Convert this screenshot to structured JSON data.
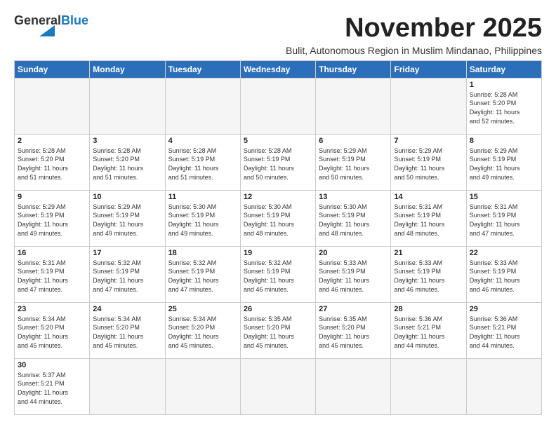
{
  "logo": {
    "general": "General",
    "blue": "Blue"
  },
  "title": "November 2025",
  "subtitle": "Bulit, Autonomous Region in Muslim Mindanao, Philippines",
  "days_of_week": [
    "Sunday",
    "Monday",
    "Tuesday",
    "Wednesday",
    "Thursday",
    "Friday",
    "Saturday"
  ],
  "weeks": [
    [
      {
        "day": "",
        "info": ""
      },
      {
        "day": "",
        "info": ""
      },
      {
        "day": "",
        "info": ""
      },
      {
        "day": "",
        "info": ""
      },
      {
        "day": "",
        "info": ""
      },
      {
        "day": "",
        "info": ""
      },
      {
        "day": "1",
        "info": "Sunrise: 5:28 AM\nSunset: 5:20 PM\nDaylight: 11 hours\nand 52 minutes."
      }
    ],
    [
      {
        "day": "2",
        "info": "Sunrise: 5:28 AM\nSunset: 5:20 PM\nDaylight: 11 hours\nand 51 minutes."
      },
      {
        "day": "3",
        "info": "Sunrise: 5:28 AM\nSunset: 5:20 PM\nDaylight: 11 hours\nand 51 minutes."
      },
      {
        "day": "4",
        "info": "Sunrise: 5:28 AM\nSunset: 5:19 PM\nDaylight: 11 hours\nand 51 minutes."
      },
      {
        "day": "5",
        "info": "Sunrise: 5:28 AM\nSunset: 5:19 PM\nDaylight: 11 hours\nand 50 minutes."
      },
      {
        "day": "6",
        "info": "Sunrise: 5:29 AM\nSunset: 5:19 PM\nDaylight: 11 hours\nand 50 minutes."
      },
      {
        "day": "7",
        "info": "Sunrise: 5:29 AM\nSunset: 5:19 PM\nDaylight: 11 hours\nand 50 minutes."
      },
      {
        "day": "8",
        "info": "Sunrise: 5:29 AM\nSunset: 5:19 PM\nDaylight: 11 hours\nand 49 minutes."
      }
    ],
    [
      {
        "day": "9",
        "info": "Sunrise: 5:29 AM\nSunset: 5:19 PM\nDaylight: 11 hours\nand 49 minutes."
      },
      {
        "day": "10",
        "info": "Sunrise: 5:29 AM\nSunset: 5:19 PM\nDaylight: 11 hours\nand 49 minutes."
      },
      {
        "day": "11",
        "info": "Sunrise: 5:30 AM\nSunset: 5:19 PM\nDaylight: 11 hours\nand 49 minutes."
      },
      {
        "day": "12",
        "info": "Sunrise: 5:30 AM\nSunset: 5:19 PM\nDaylight: 11 hours\nand 48 minutes."
      },
      {
        "day": "13",
        "info": "Sunrise: 5:30 AM\nSunset: 5:19 PM\nDaylight: 11 hours\nand 48 minutes."
      },
      {
        "day": "14",
        "info": "Sunrise: 5:31 AM\nSunset: 5:19 PM\nDaylight: 11 hours\nand 48 minutes."
      },
      {
        "day": "15",
        "info": "Sunrise: 5:31 AM\nSunset: 5:19 PM\nDaylight: 11 hours\nand 47 minutes."
      }
    ],
    [
      {
        "day": "16",
        "info": "Sunrise: 5:31 AM\nSunset: 5:19 PM\nDaylight: 11 hours\nand 47 minutes."
      },
      {
        "day": "17",
        "info": "Sunrise: 5:32 AM\nSunset: 5:19 PM\nDaylight: 11 hours\nand 47 minutes."
      },
      {
        "day": "18",
        "info": "Sunrise: 5:32 AM\nSunset: 5:19 PM\nDaylight: 11 hours\nand 47 minutes."
      },
      {
        "day": "19",
        "info": "Sunrise: 5:32 AM\nSunset: 5:19 PM\nDaylight: 11 hours\nand 46 minutes."
      },
      {
        "day": "20",
        "info": "Sunrise: 5:33 AM\nSunset: 5:19 PM\nDaylight: 11 hours\nand 46 minutes."
      },
      {
        "day": "21",
        "info": "Sunrise: 5:33 AM\nSunset: 5:19 PM\nDaylight: 11 hours\nand 46 minutes."
      },
      {
        "day": "22",
        "info": "Sunrise: 5:33 AM\nSunset: 5:19 PM\nDaylight: 11 hours\nand 46 minutes."
      }
    ],
    [
      {
        "day": "23",
        "info": "Sunrise: 5:34 AM\nSunset: 5:20 PM\nDaylight: 11 hours\nand 45 minutes."
      },
      {
        "day": "24",
        "info": "Sunrise: 5:34 AM\nSunset: 5:20 PM\nDaylight: 11 hours\nand 45 minutes."
      },
      {
        "day": "25",
        "info": "Sunrise: 5:34 AM\nSunset: 5:20 PM\nDaylight: 11 hours\nand 45 minutes."
      },
      {
        "day": "26",
        "info": "Sunrise: 5:35 AM\nSunset: 5:20 PM\nDaylight: 11 hours\nand 45 minutes."
      },
      {
        "day": "27",
        "info": "Sunrise: 5:35 AM\nSunset: 5:20 PM\nDaylight: 11 hours\nand 45 minutes."
      },
      {
        "day": "28",
        "info": "Sunrise: 5:36 AM\nSunset: 5:21 PM\nDaylight: 11 hours\nand 44 minutes."
      },
      {
        "day": "29",
        "info": "Sunrise: 5:36 AM\nSunset: 5:21 PM\nDaylight: 11 hours\nand 44 minutes."
      }
    ],
    [
      {
        "day": "30",
        "info": "Sunrise: 5:37 AM\nSunset: 5:21 PM\nDaylight: 11 hours\nand 44 minutes."
      },
      {
        "day": "",
        "info": ""
      },
      {
        "day": "",
        "info": ""
      },
      {
        "day": "",
        "info": ""
      },
      {
        "day": "",
        "info": ""
      },
      {
        "day": "",
        "info": ""
      },
      {
        "day": "",
        "info": ""
      }
    ]
  ]
}
